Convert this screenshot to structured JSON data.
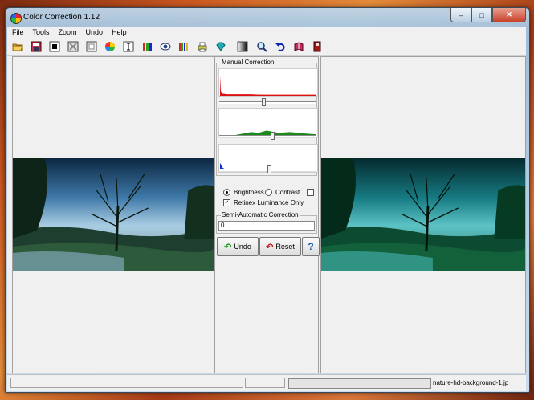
{
  "window": {
    "title": "Color Correction 1.12"
  },
  "caption_buttons": {
    "minimize": "–",
    "maximize": "□",
    "close": "✕"
  },
  "menu": [
    "File",
    "Tools",
    "Zoom",
    "Undo",
    "Help"
  ],
  "toolbar": {
    "icons": [
      "open-folder-icon",
      "save-disk-icon",
      "black-square-icon",
      "crossed-square-icon",
      "white-square-icon",
      "color-wheel-icon",
      "text-cursor-icon",
      "rgb-bars-icon",
      "eye-icon",
      "palette-bars-icon",
      "printer-icon",
      "diamond-icon",
      "gradient-icon",
      "zoom-icon",
      "undo-arrow-icon",
      "book-icon",
      "device-icon"
    ]
  },
  "manual_correction": {
    "title": "Manual Correction"
  },
  "sliders": {
    "red": 0.46,
    "green": 0.56,
    "blue": 0.52
  },
  "mode": {
    "brightness_label": "Brightness",
    "contrast_label": "Contrast",
    "third_label": "",
    "selected": "brightness",
    "retinex_label": "Retinex Luminance Only",
    "retinex_checked": true
  },
  "semi_auto": {
    "title": "Semi-Automatic Correction",
    "value": "0"
  },
  "buttons": {
    "undo": "Undo",
    "reset": "Reset",
    "help": "?"
  },
  "status": {
    "progress": 0,
    "filename": "nature-hd-background-1.jp"
  },
  "colors": {
    "red": "#d11",
    "green": "#1a8a1a",
    "blue": "#1133cc"
  }
}
